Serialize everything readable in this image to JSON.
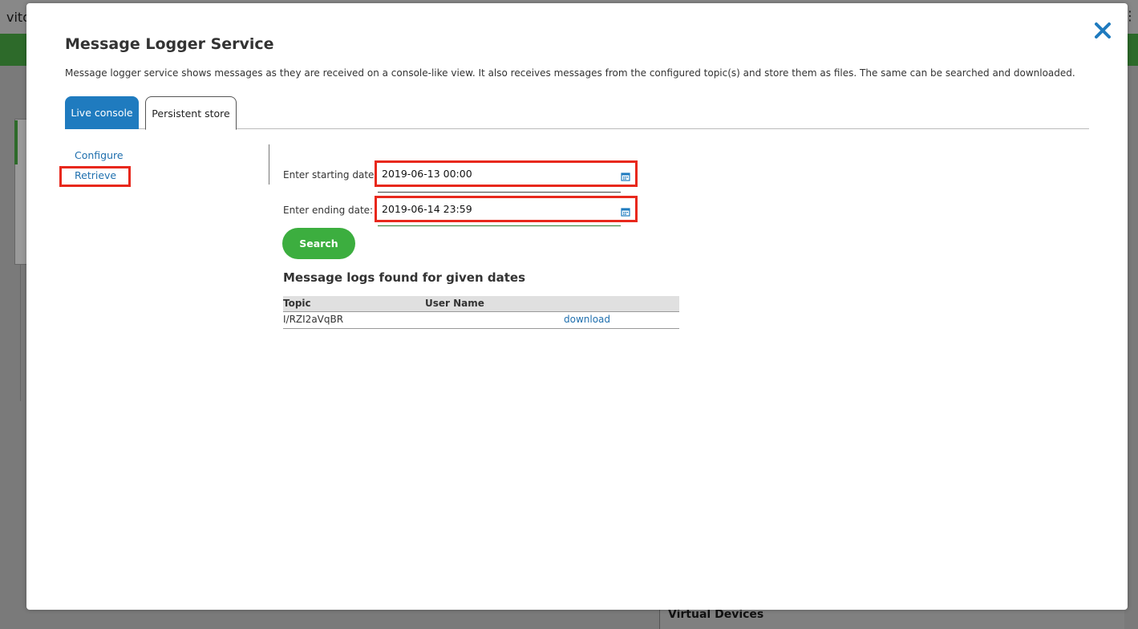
{
  "background": {
    "brand": "vito",
    "menu_icon": "more-vertical-icon",
    "panel_title": "Virtual Devices"
  },
  "modal": {
    "title": "Message Logger Service",
    "description": "Message logger service shows messages as they are received on a console-like view. It also receives messages from the configured topic(s) and store them as files. The same can be searched and downloaded.",
    "close_icon": "close-icon",
    "accent_color": "#1f7bbf",
    "tabs": [
      {
        "label": "Live console"
      },
      {
        "label": "Persistent store",
        "active": true
      }
    ],
    "sidebar": {
      "items": [
        {
          "label": "Configure"
        },
        {
          "label": "Retrieve",
          "selected": true
        }
      ]
    },
    "form": {
      "start_label": "Enter starting date:",
      "start_value": "2019-06-13 00:00",
      "end_label": "Enter ending date:",
      "end_value": "2019-06-14 23:59",
      "calendar_icon": "calendar-icon",
      "search_label": "Search",
      "search_color": "#3cae3f"
    },
    "results": {
      "title": "Message logs found for given dates",
      "columns": [
        "Topic",
        "User Name",
        ""
      ],
      "rows": [
        {
          "topic": "I/RZI2aVqBR",
          "user_name": "",
          "action": "download"
        }
      ]
    },
    "highlight_color": "#e8281c"
  }
}
